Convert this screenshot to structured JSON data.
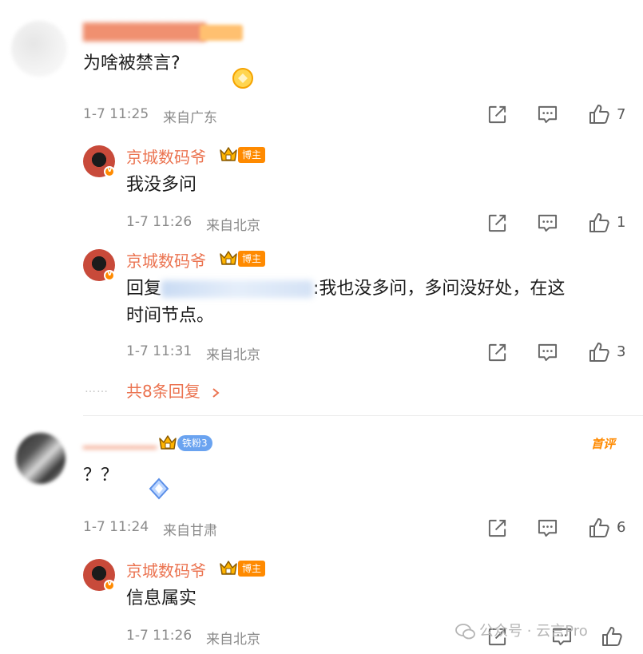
{
  "comments": [
    {
      "text": "为啥被禁言?",
      "time": "1-7 11:25",
      "location": "来自广东",
      "likes": "7",
      "replies": [
        {
          "name": "京城数码爷",
          "badge": "博主",
          "text": "我没多问",
          "time": "1-7 11:26",
          "location": "来自北京",
          "likes": "1"
        },
        {
          "name": "京城数码爷",
          "badge": "博主",
          "text_prefix": "回复",
          "text_line1": ":我也没多问，多问没好处，在这",
          "text_line2": "时间节点。",
          "time": "1-7 11:31",
          "location": "来自北京",
          "likes": "3"
        }
      ],
      "more_replies": "共8条回复"
    },
    {
      "fan_badge": "铁粉3",
      "first_tag": "首评",
      "text": "？？",
      "time": "1-7 11:24",
      "location": "来自甘肃",
      "likes": "6",
      "replies": [
        {
          "name": "京城数码爷",
          "badge": "博主",
          "text": "信息属实",
          "time": "1-7 11:26",
          "location": "来自北京"
        }
      ]
    }
  ],
  "watermark": "公众号 · 云言Pro",
  "icons": {
    "share": "share-icon",
    "comment": "comment-icon",
    "like": "like-icon",
    "crown": "crown-icon",
    "chevron": "chevron-right-icon"
  },
  "colors": {
    "accent": "#eb7350",
    "host_badge": "#ff8a00",
    "fan_badge": "#6aa3f0",
    "meta": "#8a8a8a"
  }
}
